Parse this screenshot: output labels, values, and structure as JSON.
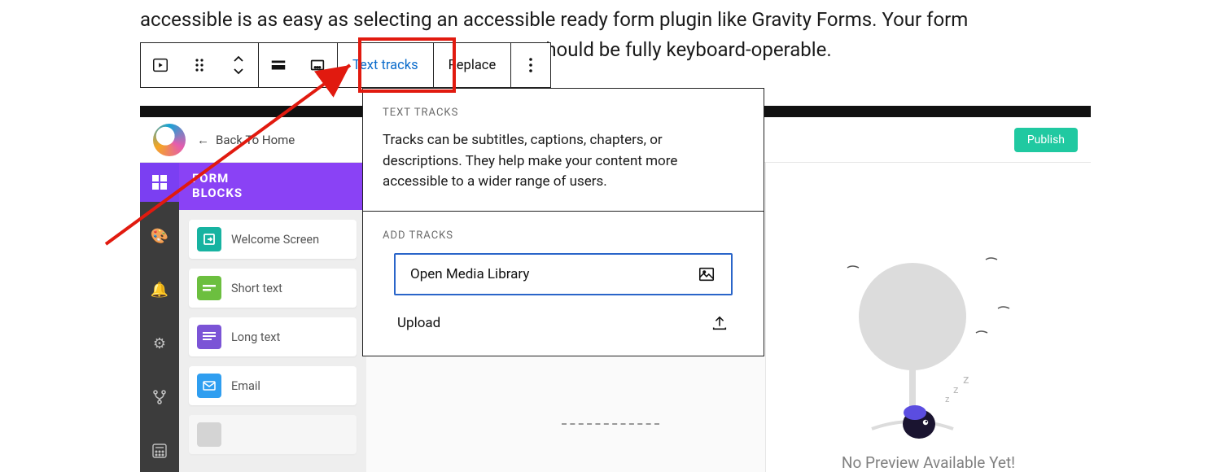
{
  "article": {
    "line1": "accessible is as easy as selecting an accessible ready form plugin like Gravity Forms. Your form",
    "line2_right": " should be fully keyboard-operable."
  },
  "toolbar": {
    "text_tracks": "Text tracks",
    "replace": "Replace"
  },
  "popover": {
    "heading1": "TEXT TRACKS",
    "body": "Tracks can be subtitles, captions, chapters, or descriptions. They help make your content more accessible to a wider range of users.",
    "heading2": "ADD TRACKS",
    "open_media": "Open Media Library",
    "upload": "Upload"
  },
  "canvas": {
    "back": "Back To Home",
    "publish": "Publish",
    "sidebar_title_a": "FORM",
    "sidebar_title_b": "BLOCKS",
    "blocks": {
      "welcome": "Welcome Screen",
      "short": "Short text",
      "long": "Long text",
      "email": "Email"
    },
    "preview_caption": "No Preview Available Yet!"
  }
}
